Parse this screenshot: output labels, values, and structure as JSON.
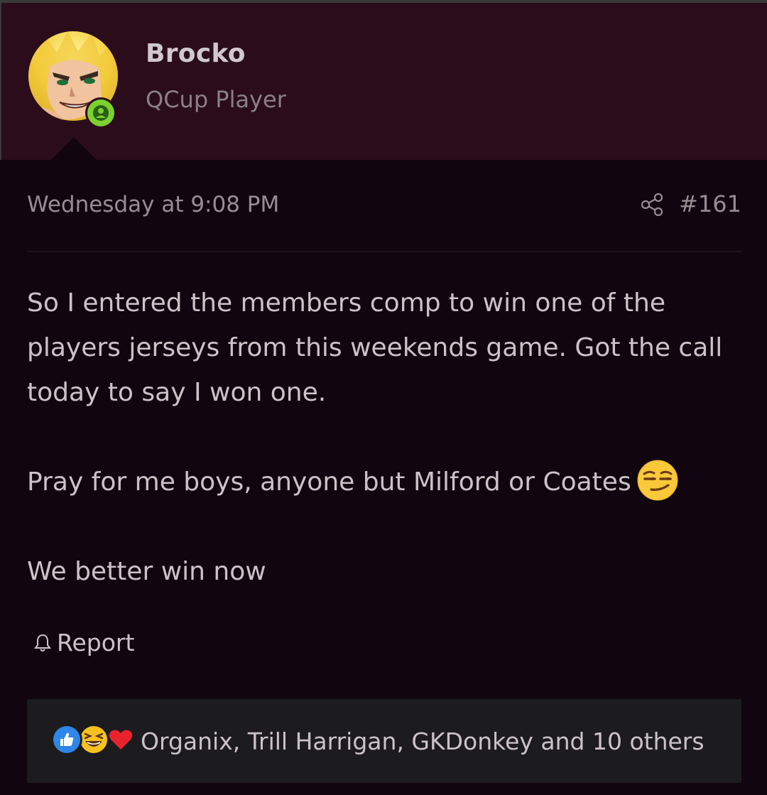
{
  "user": {
    "name": "Brocko",
    "title": "QCup Player"
  },
  "post": {
    "timestamp": "Wednesday at 9:08 PM",
    "number": "#161",
    "paragraphs": [
      "So I entered the members comp to win one of the players jerseys from this weekends game. Got the call today to say I won one.",
      "Pray for me boys, anyone but Milford or Coates",
      "We better win now"
    ],
    "emoji": "smirking-face"
  },
  "actions": {
    "report_label": "Report"
  },
  "reactions": {
    "icons": [
      "like-icon",
      "laugh-icon",
      "love-icon"
    ],
    "summary": "Organix, Trill Harrigan, GKDonkey and 10 others"
  },
  "colors": {
    "header_bg": "#2b0c1b",
    "page_bg": "#11060f",
    "online": "#7bd12e",
    "like": "#2d86e8",
    "love": "#e8232e",
    "laugh": "#f7c21f"
  }
}
